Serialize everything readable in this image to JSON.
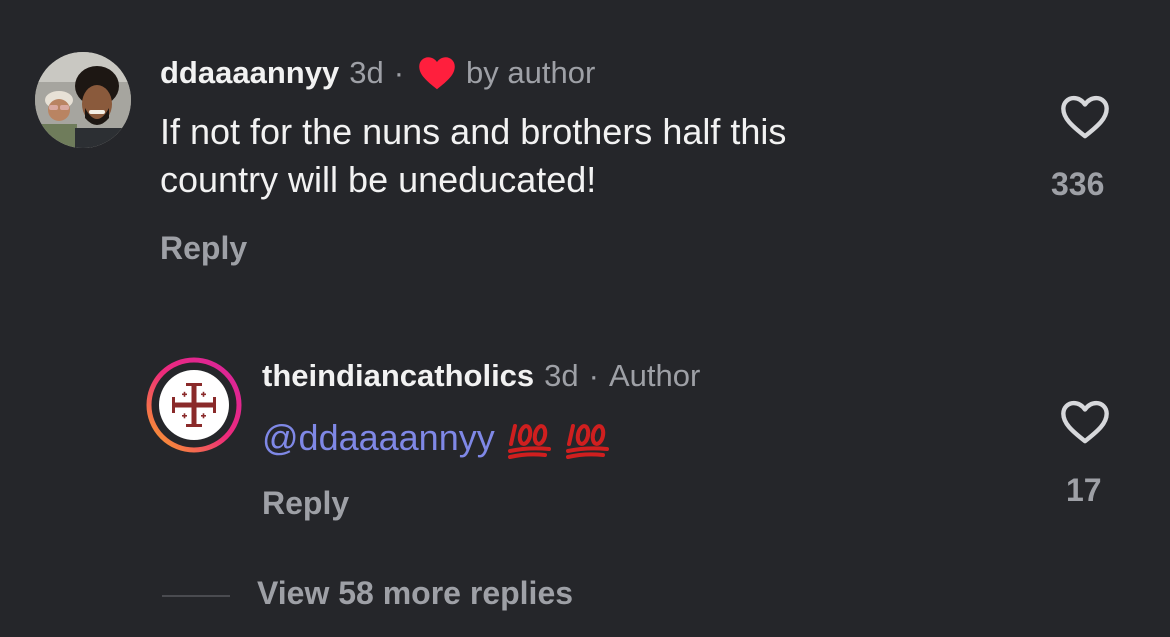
{
  "colors": {
    "background": "#25262a",
    "primary_text": "#f2f2f2",
    "secondary_text": "#9ea0a6",
    "mention": "#7f88e6",
    "like_heart": "#ff3040",
    "story_ring_start": "#f9a825",
    "story_ring_end": "#d6249f"
  },
  "comments": [
    {
      "username": "ddaaaannyy",
      "time": "3d",
      "separator": "·",
      "liked_by_author_icon": "red-heart-icon",
      "liked_by_author_label": "by author",
      "text_lines": [
        "If not for the nuns and brothers half this",
        "country will be uneducated!"
      ],
      "reply_label": "Reply",
      "like_icon": "heart-outline-icon",
      "like_count": "336"
    }
  ],
  "replies": [
    {
      "username": "theindiancatholics",
      "time": "3d",
      "separator": "·",
      "author_badge": "Author",
      "mention": "@ddaaaannyy",
      "emoji": [
        "hundred-points-emoji",
        "hundred-points-emoji"
      ],
      "reply_label": "Reply",
      "like_icon": "heart-outline-icon",
      "like_count": "17"
    }
  ],
  "view_more_replies": "View 58 more replies"
}
